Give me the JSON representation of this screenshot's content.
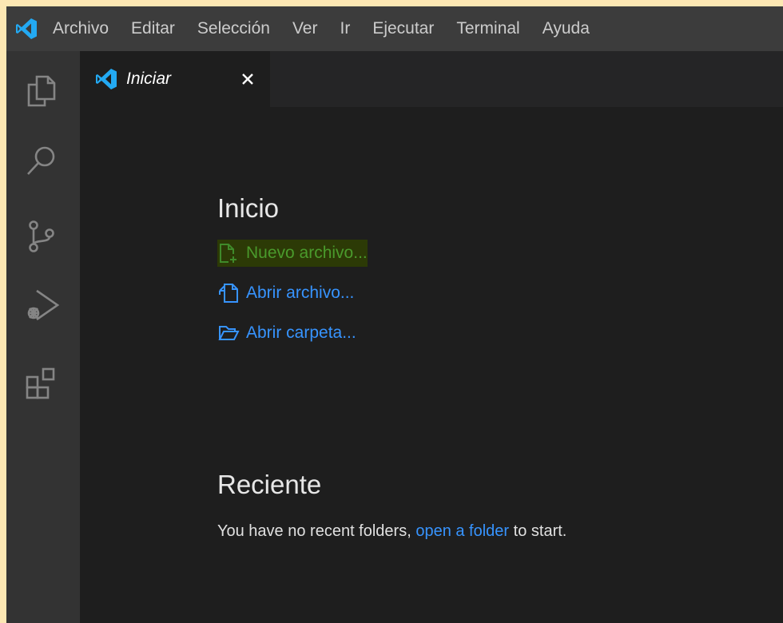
{
  "menubar": {
    "items": [
      "Archivo",
      "Editar",
      "Selección",
      "Ver",
      "Ir",
      "Ejecutar",
      "Terminal",
      "Ayuda"
    ]
  },
  "activitybar": {
    "icons": [
      "explorer-icon",
      "search-icon",
      "source-control-icon",
      "run-debug-icon",
      "extensions-icon"
    ]
  },
  "tab": {
    "label": "Iniciar",
    "close": "×"
  },
  "start": {
    "title": "Inicio",
    "actions": {
      "new_file": "Nuevo archivo...",
      "open_file": "Abrir archivo...",
      "open_folder": "Abrir carpeta..."
    }
  },
  "recent": {
    "title": "Reciente",
    "text_before": "You have no recent folders,",
    "link": "open a folder",
    "text_after": "to start."
  },
  "colors": {
    "link": "#3794ff",
    "accent": "#0a84d8",
    "highlight_bg": "#2c3a06"
  }
}
